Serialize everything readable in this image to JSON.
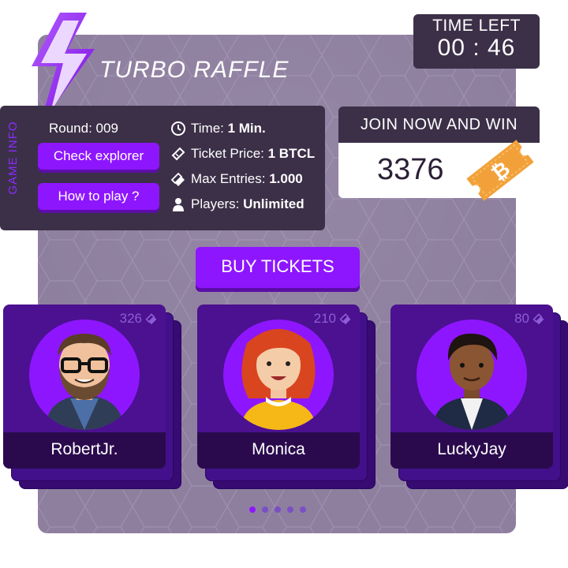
{
  "game": {
    "title": "TURBO RAFFLE"
  },
  "timer": {
    "label": "TIME LEFT",
    "value": "00 : 46"
  },
  "info": {
    "side_label": "GAME INFO",
    "round": "Round: 009",
    "check_explorer": "Check explorer",
    "how_to_play": "How to play ?",
    "time_label": "Time: ",
    "time_value": "1 Min.",
    "price_label": "Ticket Price: ",
    "price_value": "1 BTCL",
    "entries_label": "Max Entries: ",
    "entries_value": "1.000",
    "players_label": "Players: ",
    "players_value": "Unlimited"
  },
  "join": {
    "label": "JOIN NOW AND WIN",
    "amount": "3376"
  },
  "buy_tickets": "BUY TICKETS",
  "players": [
    {
      "name": "RobertJr.",
      "tickets": "326"
    },
    {
      "name": "Monica",
      "tickets": "210"
    },
    {
      "name": "LuckyJay",
      "tickets": "80"
    }
  ],
  "pagination": {
    "total": 5,
    "active": 1
  },
  "colors": {
    "accent": "#8e16ff",
    "panel": "#3c3048",
    "card": "#4b1190",
    "ticket_orange": "#f2a13a"
  },
  "icons": [
    "lightning-icon",
    "clock-icon",
    "ticket-icon",
    "tickets-icon",
    "user-icon",
    "bitcoin-ticket-icon"
  ]
}
